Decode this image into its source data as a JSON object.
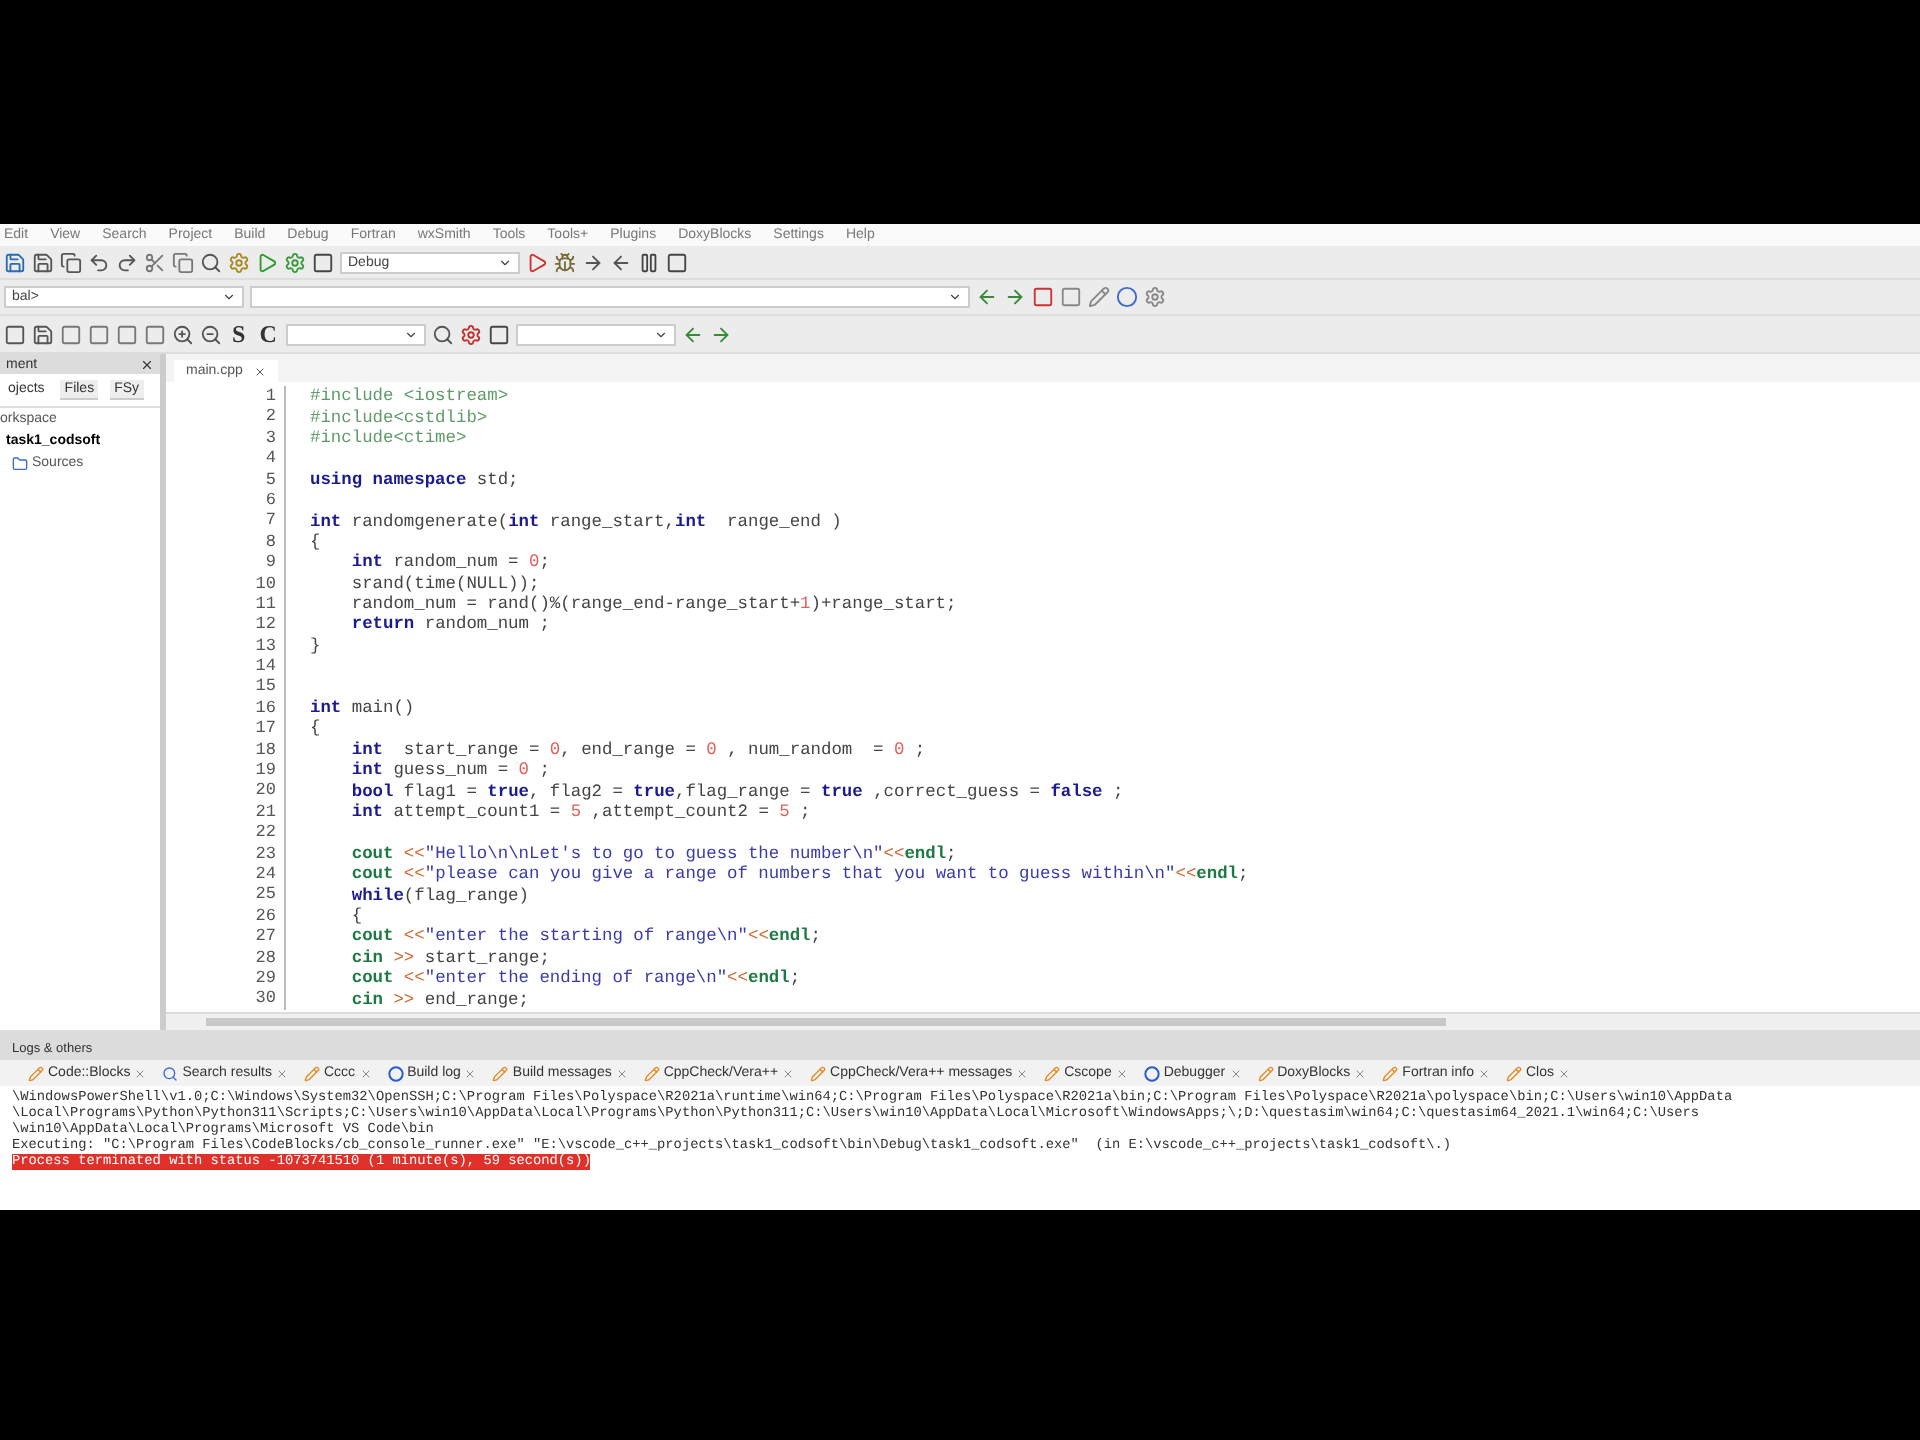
{
  "menu_bar": [
    "Edit",
    "View",
    "Search",
    "Project",
    "Build",
    "Debug",
    "Fortran",
    "wxSmith",
    "Tools",
    "Tools+",
    "Plugins",
    "DoxyBlocks",
    "Settings",
    "Help"
  ],
  "toolbar": {
    "build_target": "Debug",
    "scope_field": "bal>",
    "letters": [
      "S",
      "C"
    ]
  },
  "management": {
    "title": "ment",
    "tabs": [
      {
        "label": "ojects",
        "selected": true
      },
      {
        "label": "Files",
        "selected": false
      },
      {
        "label": "FSy",
        "selected": false
      }
    ],
    "tree": [
      {
        "label": "orkspace",
        "active": false,
        "children": [
          {
            "label": "task1_codsoft",
            "active": true,
            "children": [
              {
                "label": "Sources",
                "active": false
              }
            ]
          }
        ]
      }
    ]
  },
  "editor": {
    "tab": "main.cpp",
    "lines": [
      {
        "number": "1",
        "tokens": [
          {
            "kind": "pp",
            "text": "#include <iostream>"
          }
        ]
      },
      {
        "number": "2",
        "tokens": [
          {
            "kind": "pp",
            "text": "#include<cstdlib>"
          }
        ]
      },
      {
        "number": "3",
        "tokens": [
          {
            "kind": "pp",
            "text": "#include<ctime>"
          }
        ]
      },
      {
        "number": "4"
      },
      {
        "number": "5",
        "tokens": [
          {
            "kind": "kw",
            "text": "using namespace"
          },
          {
            "kind": "plain",
            "text": " std;"
          }
        ]
      },
      {
        "number": "6"
      },
      {
        "number": "7",
        "tokens": [
          {
            "kind": "kw",
            "text": "int"
          },
          {
            "kind": "plain",
            "text": " randomgenerate("
          },
          {
            "kind": "kw",
            "text": "int"
          },
          {
            "kind": "plain",
            "text": " range_start,"
          },
          {
            "kind": "kw",
            "text": "int"
          },
          {
            "kind": "plain",
            "text": "  range_end )"
          }
        ]
      },
      {
        "number": "8",
        "tokens": [
          {
            "kind": "plain",
            "text": "{"
          }
        ]
      },
      {
        "number": "9",
        "tokens": [
          {
            "kind": "kw",
            "text": "    int"
          },
          {
            "kind": "plain",
            "text": " random_num = "
          },
          {
            "kind": "num",
            "text": "0"
          },
          {
            "kind": "plain",
            "text": ";"
          }
        ]
      },
      {
        "number": "10",
        "tokens": [
          {
            "kind": "plain",
            "text": "    srand(time(NULL));"
          }
        ]
      },
      {
        "number": "11",
        "tokens": [
          {
            "kind": "plain",
            "text": "    random_num = rand()%(range_end-range_start+"
          },
          {
            "kind": "num",
            "text": "1"
          },
          {
            "kind": "plain",
            "text": ")+range_start;"
          }
        ]
      },
      {
        "number": "12",
        "tokens": [
          {
            "kind": "kw",
            "text": "    return"
          },
          {
            "kind": "plain",
            "text": " random_num ;"
          }
        ]
      },
      {
        "number": "13",
        "tokens": [
          {
            "kind": "plain",
            "text": "}"
          }
        ]
      },
      {
        "number": "14"
      },
      {
        "number": "15"
      },
      {
        "number": "16",
        "tokens": [
          {
            "kind": "kw",
            "text": "int"
          },
          {
            "kind": "plain",
            "text": " main()"
          }
        ]
      },
      {
        "number": "17",
        "tokens": [
          {
            "kind": "plain",
            "text": "{"
          }
        ]
      },
      {
        "number": "18",
        "tokens": [
          {
            "kind": "kw",
            "text": "    int"
          },
          {
            "kind": "plain",
            "text": "  start_range = "
          },
          {
            "kind": "num",
            "text": "0"
          },
          {
            "kind": "plain",
            "text": ", end_range = "
          },
          {
            "kind": "num",
            "text": "0"
          },
          {
            "kind": "plain",
            "text": " , num_random  = "
          },
          {
            "kind": "num",
            "text": "0"
          },
          {
            "kind": "plain",
            "text": " ;"
          }
        ]
      },
      {
        "number": "19",
        "tokens": [
          {
            "kind": "kw",
            "text": "    int"
          },
          {
            "kind": "plain",
            "text": " guess_num = "
          },
          {
            "kind": "num",
            "text": "0"
          },
          {
            "kind": "plain",
            "text": " ;"
          }
        ]
      },
      {
        "number": "20",
        "tokens": [
          {
            "kind": "kw",
            "text": "    bool"
          },
          {
            "kind": "plain",
            "text": " flag1 = "
          },
          {
            "kind": "kw",
            "text": "true"
          },
          {
            "kind": "plain",
            "text": ", flag2 = "
          },
          {
            "kind": "kw",
            "text": "true"
          },
          {
            "kind": "plain",
            "text": ",flag_range = "
          },
          {
            "kind": "kw",
            "text": "true"
          },
          {
            "kind": "plain",
            "text": " ,correct_guess = "
          },
          {
            "kind": "kw",
            "text": "false"
          },
          {
            "kind": "plain",
            "text": " ;"
          }
        ]
      },
      {
        "number": "21",
        "tokens": [
          {
            "kind": "kw",
            "text": "    int"
          },
          {
            "kind": "plain",
            "text": " attempt_count1 = "
          },
          {
            "kind": "num",
            "text": "5"
          },
          {
            "kind": "plain",
            "text": " ,attempt_count2 = "
          },
          {
            "kind": "num",
            "text": "5"
          },
          {
            "kind": "plain",
            "text": " ;"
          }
        ]
      },
      {
        "number": "22"
      },
      {
        "number": "23",
        "tokens": [
          {
            "kind": "io",
            "text": "    cout"
          },
          {
            "kind": "op",
            "text": " <<"
          },
          {
            "kind": "str",
            "text": "\"Hello\\n\\nLet's to go to guess the number\\n\""
          },
          {
            "kind": "op",
            "text": "<<"
          },
          {
            "kind": "io",
            "text": "endl"
          },
          {
            "kind": "plain",
            "text": ";"
          }
        ]
      },
      {
        "number": "24",
        "tokens": [
          {
            "kind": "io",
            "text": "    cout"
          },
          {
            "kind": "op",
            "text": " <<"
          },
          {
            "kind": "str",
            "text": "\"please can you give a range of numbers that you want to guess within\\n\""
          },
          {
            "kind": "op",
            "text": "<<"
          },
          {
            "kind": "io",
            "text": "endl"
          },
          {
            "kind": "plain",
            "text": ";"
          }
        ]
      },
      {
        "number": "25",
        "tokens": [
          {
            "kind": "kw",
            "text": "    while"
          },
          {
            "kind": "plain",
            "text": "(flag_range)"
          }
        ]
      },
      {
        "number": "26",
        "tokens": [
          {
            "kind": "plain",
            "text": "    {"
          }
        ]
      },
      {
        "number": "27",
        "tokens": [
          {
            "kind": "io",
            "text": "    cout"
          },
          {
            "kind": "op",
            "text": " <<"
          },
          {
            "kind": "str",
            "text": "\"enter the starting of range\\n\""
          },
          {
            "kind": "op",
            "text": "<<"
          },
          {
            "kind": "io",
            "text": "endl"
          },
          {
            "kind": "plain",
            "text": ";"
          }
        ]
      },
      {
        "number": "28",
        "tokens": [
          {
            "kind": "io",
            "text": "    cin"
          },
          {
            "kind": "op",
            "text": " >>"
          },
          {
            "kind": "plain",
            "text": " start_range;"
          }
        ]
      },
      {
        "number": "29",
        "tokens": [
          {
            "kind": "io",
            "text": "    cout"
          },
          {
            "kind": "op",
            "text": " <<"
          },
          {
            "kind": "str",
            "text": "\"enter the ending of range\\n\""
          },
          {
            "kind": "op",
            "text": "<<"
          },
          {
            "kind": "io",
            "text": "endl"
          },
          {
            "kind": "plain",
            "text": ";"
          }
        ]
      },
      {
        "number": "30",
        "tokens": [
          {
            "kind": "io",
            "text": "    cin"
          },
          {
            "kind": "op",
            "text": " >>"
          },
          {
            "kind": "plain",
            "text": " end_range;"
          }
        ]
      }
    ]
  },
  "logs": {
    "title": "Logs & others",
    "tabs": [
      "Code::Blocks",
      "Search results",
      "Cccc",
      "Build log",
      "Build messages",
      "CppCheck/Vera++",
      "CppCheck/Vera++ messages",
      "Cscope",
      "Debugger",
      "DoxyBlocks",
      "Fortran info",
      "Clos"
    ],
    "lines": [
      {
        "kind": "info",
        "text": "\\WindowsPowerShell\\v1.0;C:\\Windows\\System32\\OpenSSH;C:\\Program Files\\Polyspace\\R2021a\\runtime\\win64;C:\\Program Files\\Polyspace\\R2021a\\bin;C:\\Program Files\\Polyspace\\R2021a\\polyspace\\bin;C:\\Users\\win10\\AppData"
      },
      {
        "kind": "info",
        "text": "\\Local\\Programs\\Python\\Python311\\Scripts;C:\\Users\\win10\\AppData\\Local\\Programs\\Python\\Python311;C:\\Users\\win10\\AppData\\Local\\Microsoft\\WindowsApps;\\;D:\\questasim\\win64;C:\\questasim64_2021.1\\win64;C:\\Users"
      },
      {
        "kind": "info",
        "text": "\\win10\\AppData\\Local\\Programs\\Microsoft VS Code\\bin"
      },
      {
        "kind": "info",
        "text": "Executing: \"C:\\Program Files\\CodeBlocks/cb_console_runner.exe\" \"E:\\vscode_c++_projects\\task1_codsoft\\bin\\Debug\\task1_codsoft.exe\"  (in E:\\vscode_c++_projects\\task1_codsoft\\.)"
      },
      {
        "kind": "error",
        "text": "Process terminated with status -1073741510 (1 minute(s), 59 second(s))"
      }
    ]
  }
}
